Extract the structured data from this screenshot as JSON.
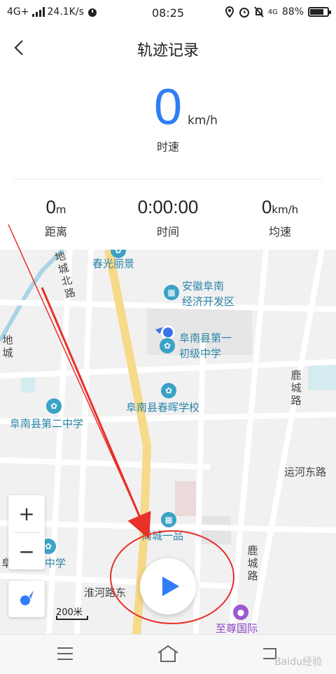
{
  "status_bar": {
    "network": "4G+",
    "speed": "24.1K/s",
    "time": "08:25",
    "network_right": "4G",
    "battery": "88%",
    "battery_level": 0.88
  },
  "header": {
    "title": "轨迹记录"
  },
  "speed": {
    "value": "0",
    "unit": "km/h",
    "label": "时速"
  },
  "stats": [
    {
      "value": "0",
      "unit": "m",
      "label": "距离"
    },
    {
      "value": "0:00:00",
      "unit": "",
      "label": "时间"
    },
    {
      "value": "0",
      "unit": "km/h",
      "label": "均速"
    }
  ],
  "map": {
    "pois": [
      "春光丽景",
      "安徽阜南",
      "经济开发区",
      "阜南县第一",
      "初级中学",
      "阜南县春晖学校",
      "阜南县第二中学",
      "尚城一品",
      "实验中学",
      "至尊国际"
    ],
    "streets": [
      "地城北路",
      "地城",
      "鹿城路",
      "运河东路",
      "鹿城路",
      "淮河路东",
      "阜"
    ],
    "scale": "200米",
    "zoom_in": "+",
    "zoom_out": "−"
  },
  "watermark": "Baidu经验",
  "colors": {
    "accent": "#2f7df6",
    "annotation": "#e8302a"
  }
}
